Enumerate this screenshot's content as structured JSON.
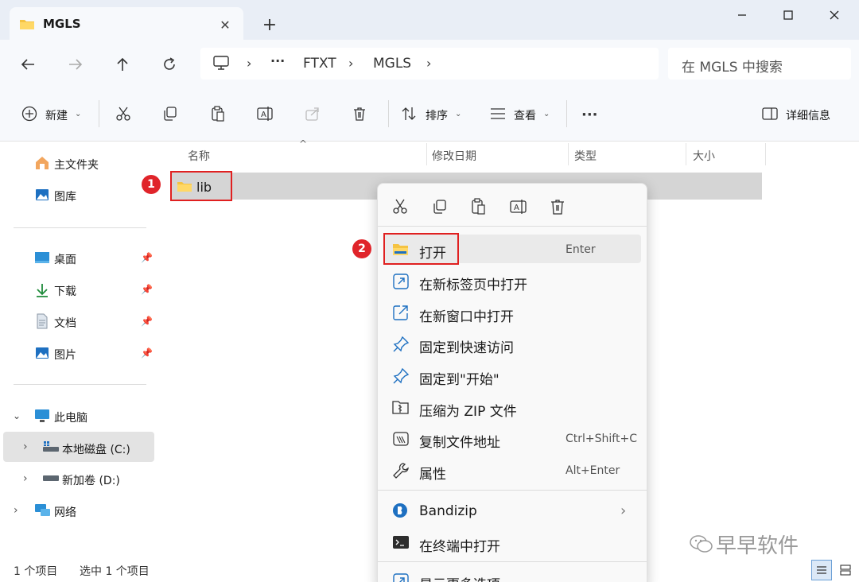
{
  "window": {
    "tab_title": "MGLS",
    "tab_close": "✕",
    "new_tab": "+"
  },
  "address": {
    "ellipsis": "···",
    "crumbs": [
      "FTXT",
      "MGLS"
    ],
    "search_placeholder": "在 MGLS 中搜索"
  },
  "toolbar": {
    "new_label": "新建",
    "sort_label": "排序",
    "view_label": "查看",
    "more_label": "···",
    "details_label": "详细信息"
  },
  "nav": {
    "home": "主文件夹",
    "gallery": "图库",
    "desktop": "桌面",
    "downloads": "下载",
    "documents": "文档",
    "pictures": "图片",
    "this_pc": "此电脑",
    "local_disk": "本地磁盘 (C:)",
    "new_volume": "新加卷 (D:)",
    "network": "网络"
  },
  "columns": {
    "name": "名称",
    "modified": "修改日期",
    "type": "类型",
    "size": "大小"
  },
  "files": [
    {
      "name": "lib"
    }
  ],
  "annotations": {
    "step1": "1",
    "step2": "2"
  },
  "context_menu": {
    "items": [
      {
        "label": "打开",
        "shortcut": "Enter"
      },
      {
        "label": "在新标签页中打开",
        "shortcut": ""
      },
      {
        "label": "在新窗口中打开",
        "shortcut": ""
      },
      {
        "label": "固定到快速访问",
        "shortcut": ""
      },
      {
        "label": "固定到\"开始\"",
        "shortcut": ""
      },
      {
        "label": "压缩为 ZIP 文件",
        "shortcut": ""
      },
      {
        "label": "复制文件地址",
        "shortcut": "Ctrl+Shift+C"
      },
      {
        "label": "属性",
        "shortcut": "Alt+Enter"
      },
      {
        "label": "Bandizip",
        "shortcut": ""
      },
      {
        "label": "在终端中打开",
        "shortcut": ""
      },
      {
        "label": "显示更多选项",
        "shortcut": ""
      }
    ]
  },
  "status": {
    "count": "1 个项目",
    "selected": "选中 1 个项目"
  },
  "watermark": "早早软件",
  "colors": {
    "accent_red": "#e02020",
    "folder_yellow": "#f5c342",
    "titlebar_bg": "#e9eef6",
    "toolbar_bg": "#f7f9fc"
  }
}
